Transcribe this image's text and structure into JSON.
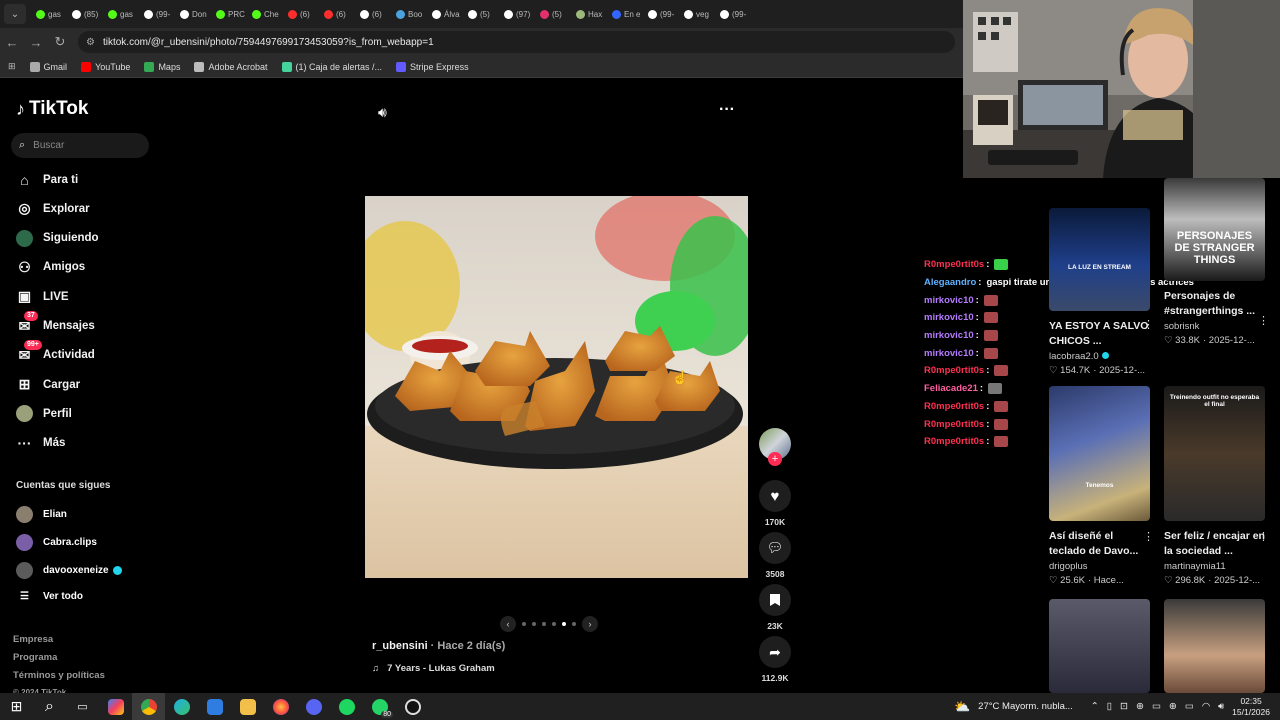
{
  "browser": {
    "tabs": [
      {
        "label": "gas",
        "color": "#53fc18"
      },
      {
        "label": "(85)",
        "color": "#ffffff"
      },
      {
        "label": "gas",
        "color": "#53fc18"
      },
      {
        "label": "(99-",
        "color": "#ffffff"
      },
      {
        "label": "Don",
        "color": "#ffffff"
      },
      {
        "label": "PRC",
        "color": "#53fc18"
      },
      {
        "label": "Che",
        "color": "#53fc18"
      },
      {
        "label": "(6)",
        "color": "#ff2d2d"
      },
      {
        "label": "(6)",
        "color": "#ff2d2d"
      },
      {
        "label": "(6)",
        "color": "#ffffff"
      },
      {
        "label": "Boo",
        "color": "#4aa3df"
      },
      {
        "label": "Álva",
        "color": "#ffffff"
      },
      {
        "label": "(5)",
        "color": "#ffffff"
      },
      {
        "label": "(97)",
        "color": "#ffffff"
      },
      {
        "label": "(5)",
        "color": "#e1306c"
      },
      {
        "label": "Hax",
        "color": "#9cb87a"
      },
      {
        "label": "En e",
        "color": "#3366ff"
      },
      {
        "label": "(99-",
        "color": "#ffffff"
      },
      {
        "label": "veg",
        "color": "#ffffff"
      },
      {
        "label": "(99-",
        "color": "#ffffff"
      }
    ],
    "url": "tiktok.com/@r_ubensini/photo/7594497699173453059?is_from_webapp=1",
    "bookmarks": [
      {
        "label": "Gmail",
        "color": "#aaaaaa"
      },
      {
        "label": "YouTube",
        "color": "#ff0000"
      },
      {
        "label": "Maps",
        "color": "#34a853"
      },
      {
        "label": "Adobe Acrobat",
        "color": "#bbbbbb"
      },
      {
        "label": "(1) Caja de alertas /...",
        "color": "#44d39a"
      },
      {
        "label": "Stripe Express",
        "color": "#635bff"
      }
    ]
  },
  "sidebar": {
    "logo": "TikTok",
    "search_placeholder": "Buscar",
    "nav": [
      {
        "label": "Para ti",
        "icon": "home-icon"
      },
      {
        "label": "Explorar",
        "icon": "compass-icon"
      },
      {
        "label": "Siguiendo",
        "icon": "following-avatar-icon"
      },
      {
        "label": "Amigos",
        "icon": "friends-icon"
      },
      {
        "label": "LIVE",
        "icon": "live-icon"
      },
      {
        "label": "Mensajes",
        "icon": "messages-icon",
        "badge": "37"
      },
      {
        "label": "Actividad",
        "icon": "activity-icon",
        "badge": "99+"
      },
      {
        "label": "Cargar",
        "icon": "upload-icon"
      },
      {
        "label": "Perfil",
        "icon": "profile-icon"
      },
      {
        "label": "Más",
        "icon": "more-icon"
      }
    ],
    "following_title": "Cuentas que sigues",
    "following": [
      "Elian",
      "Cabra.clips",
      "davooxeneize"
    ],
    "see_all": "Ver todo",
    "footer": [
      "Empresa",
      "Programa",
      "Términos y políticas",
      "© 2024 TikTok"
    ]
  },
  "post": {
    "username": "r_ubensini",
    "time": " · Hace 2 día(s)",
    "music": "7 Years - Lukas Graham",
    "slides": 6,
    "active_slide": 5,
    "likes": "170K",
    "comments": "3508",
    "saves": "23K",
    "shares": "112.9K"
  },
  "chat": [
    {
      "user": "R0mpe0rtit0s",
      "color": "#ff3050",
      "msg": "",
      "emote": "#3ad14a"
    },
    {
      "user": "Alegaandro",
      "color": "#5fb2ff",
      "msg": "gaspi tirate un formidable de mejores actrices",
      "emote": ""
    },
    {
      "user": "mirkovic10",
      "color": "#b57bff",
      "msg": "",
      "emote": "#a8474a"
    },
    {
      "user": "mirkovic10",
      "color": "#b57bff",
      "msg": "",
      "emote": "#a8474a"
    },
    {
      "user": "mirkovic10",
      "color": "#b57bff",
      "msg": "",
      "emote": "#a8474a"
    },
    {
      "user": "mirkovic10",
      "color": "#b57bff",
      "msg": "",
      "emote": "#a8474a"
    },
    {
      "user": "R0mpe0rtit0s",
      "color": "#ff3050",
      "msg": "",
      "emote": "#a8474a"
    },
    {
      "user": "Feliacade21",
      "color": "#ff5fa0",
      "msg": "",
      "emote": "#777777"
    },
    {
      "user": "R0mpe0rtit0s",
      "color": "#ff3050",
      "msg": "",
      "emote": "#a8474a"
    },
    {
      "user": "R0mpe0rtit0s",
      "color": "#ff3050",
      "msg": "",
      "emote": "#a8474a"
    },
    {
      "user": "R0mpe0rtit0s",
      "color": "#ff3050",
      "msg": "",
      "emote": "#a8474a"
    }
  ],
  "recommendations": [
    {
      "title": "YA ESTOY A SALVO CHICOS ...",
      "author": "lacobraa2.0",
      "likes": "154.7K",
      "date": "· 2025-12-...",
      "overlay": "LA LUZ EN STREAM"
    },
    {
      "title": "Personajes de #strangerthings ...",
      "author": "sobrisnk",
      "likes": "33.8K",
      "date": "· 2025-12-...",
      "overlay": "PERSONAJES DE STRANGER THINGS"
    },
    {
      "title": "Así diseñé el teclado de Davo...",
      "author": "drigoplus",
      "likes": "25.6K",
      "date": "· Hace...",
      "overlay": "Tenemos"
    },
    {
      "title": "Ser feliz / encajar en la sociedad ...",
      "author": "martinaymia11",
      "likes": "296.8K",
      "date": "· 2025-12-...",
      "overlay": "Treinendo outfit no esperaba el final"
    }
  ],
  "taskbar": {
    "weather": "27°C  Mayorm. nubla...",
    "time": "02:35",
    "date": "15/1/2026",
    "whatsapp_badge": "80"
  }
}
